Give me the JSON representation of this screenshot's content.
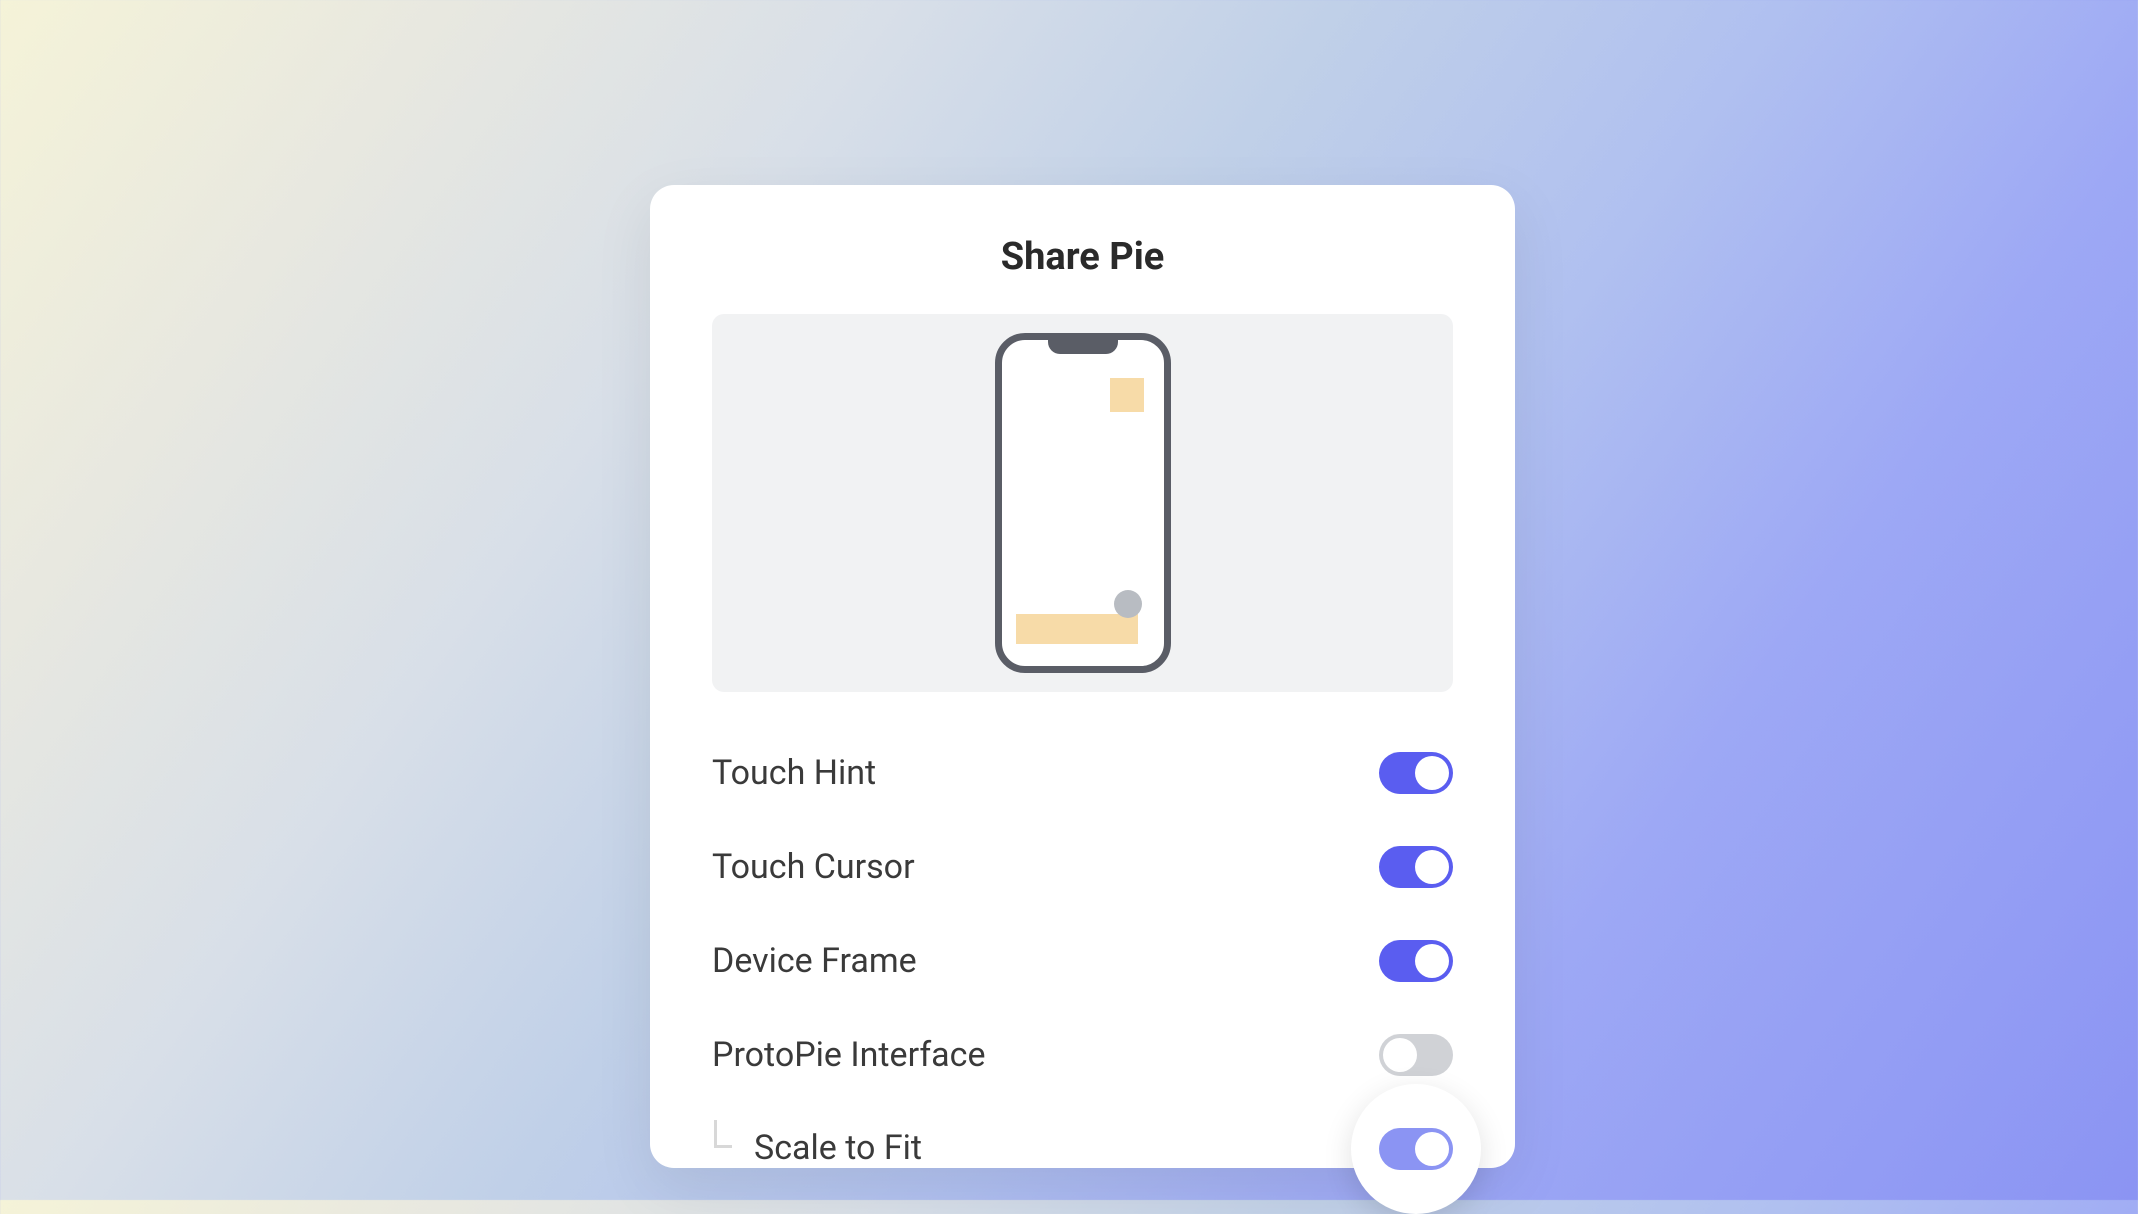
{
  "panel": {
    "title": "Share Pie"
  },
  "settings": [
    {
      "label": "Touch Hint",
      "enabled": true,
      "indented": false,
      "highlighted": false
    },
    {
      "label": "Touch Cursor",
      "enabled": true,
      "indented": false,
      "highlighted": false
    },
    {
      "label": "Device Frame",
      "enabled": true,
      "indented": false,
      "highlighted": false
    },
    {
      "label": "ProtoPie Interface",
      "enabled": false,
      "indented": false,
      "highlighted": false
    },
    {
      "label": "Scale to Fit",
      "enabled": true,
      "indented": true,
      "highlighted": true
    }
  ],
  "colors": {
    "toggle_on": "#5a5df0",
    "toggle_off": "#d0d2d6",
    "toggle_highlighted": "#8b94f3"
  }
}
